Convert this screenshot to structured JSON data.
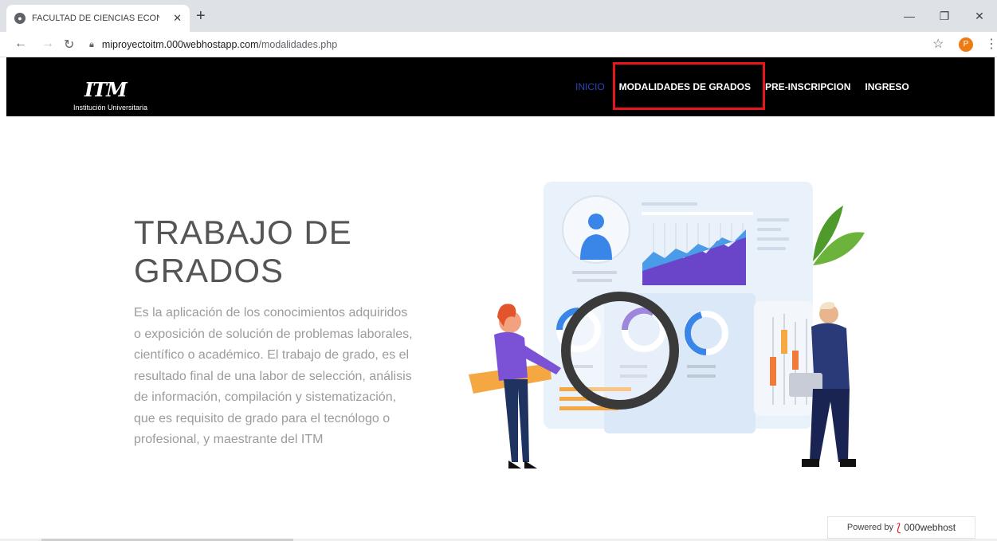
{
  "browser": {
    "tab_title": "FACULTAD DE CIENCIAS ECONÓ",
    "url_domain": "miproyectoitm.000webhostapp.com",
    "url_path": "/modalidades.php",
    "profile_initial": "P"
  },
  "site": {
    "logo_mark": "ITM",
    "logo_sub": "Institución Universitaria",
    "nav": [
      {
        "label": "INICIO"
      },
      {
        "label": "MODALIDADES DE GRADOS"
      },
      {
        "label": "PRE-INSCRIPCION"
      },
      {
        "label": "INGRESO"
      }
    ],
    "highlight_color": "#e8151c"
  },
  "hero": {
    "title_line1": "TRABAJO DE",
    "title_line2": "GRADOS",
    "text_lines": [
      "Es la aplicación de los conocimientos adquiridos",
      "o exposición de solución de problemas laborales,",
      "científico o académico. El trabajo de grado, es el",
      "resultado final de una labor de selección, análisis",
      "de información, compilación y sistematización,",
      "que es requisito de grado para el tecnólogo o",
      "profesional, y maestrante del ITM"
    ]
  },
  "badge": {
    "prefix": "Powered by",
    "name": "000webhost"
  },
  "icons": {
    "favicon": "globe-icon",
    "close": "close-icon",
    "new_tab": "plus-icon",
    "back": "arrow-left-icon",
    "forward": "arrow-right-icon",
    "reload": "reload-icon",
    "lock": "lock-icon",
    "bookmark": "star-icon",
    "menu": "kebab-menu-icon"
  }
}
